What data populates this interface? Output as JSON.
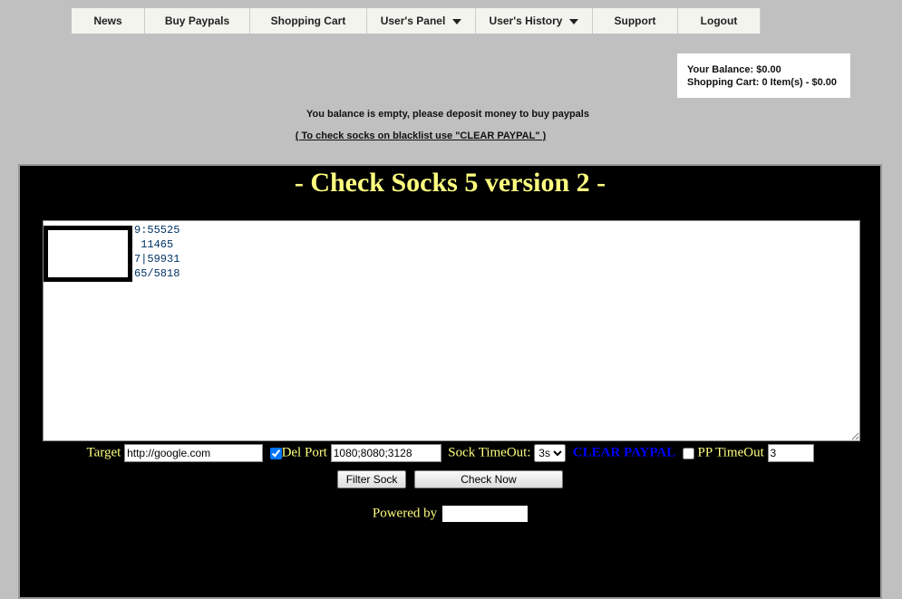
{
  "nav": [
    {
      "label": "News"
    },
    {
      "label": "Buy Paypals"
    },
    {
      "label": "Shopping Cart"
    },
    {
      "label": "User's Panel",
      "dropdown": true
    },
    {
      "label": "User's History",
      "dropdown": true
    },
    {
      "label": "Support"
    },
    {
      "label": "Logout"
    }
  ],
  "balance": {
    "balance": "Your Balance: $0.00",
    "cart": "Shopping Cart: 0 Item(s) - $0.00"
  },
  "messages": {
    "empty": "You balance is empty, please deposit money to buy paypals",
    "blacklist": "( To check socks on blacklist use \"CLEAR PAYPAL\" )"
  },
  "checker": {
    "title": "- Check Socks 5 version 2 -",
    "socks": "9:55525\n 11465\n7|59931\n65/5818",
    "target_label": "Target",
    "target_value": "http://google.com",
    "delport_label": "Del Port",
    "delport_checked": true,
    "delport_value": "1080;8080;3128",
    "timeout_label": "Sock TimeOut:",
    "timeout_value": "3s",
    "clear_paypal": "CLEAR PAYPAL",
    "clear_paypal_color": "#0000ff",
    "pp_timeout_label": "PP TimeOut",
    "pp_timeout_checked": false,
    "pp_timeout_value": "3",
    "filter_button": "Filter Sock",
    "check_button": "Check Now",
    "powered_by": "Powered by"
  }
}
